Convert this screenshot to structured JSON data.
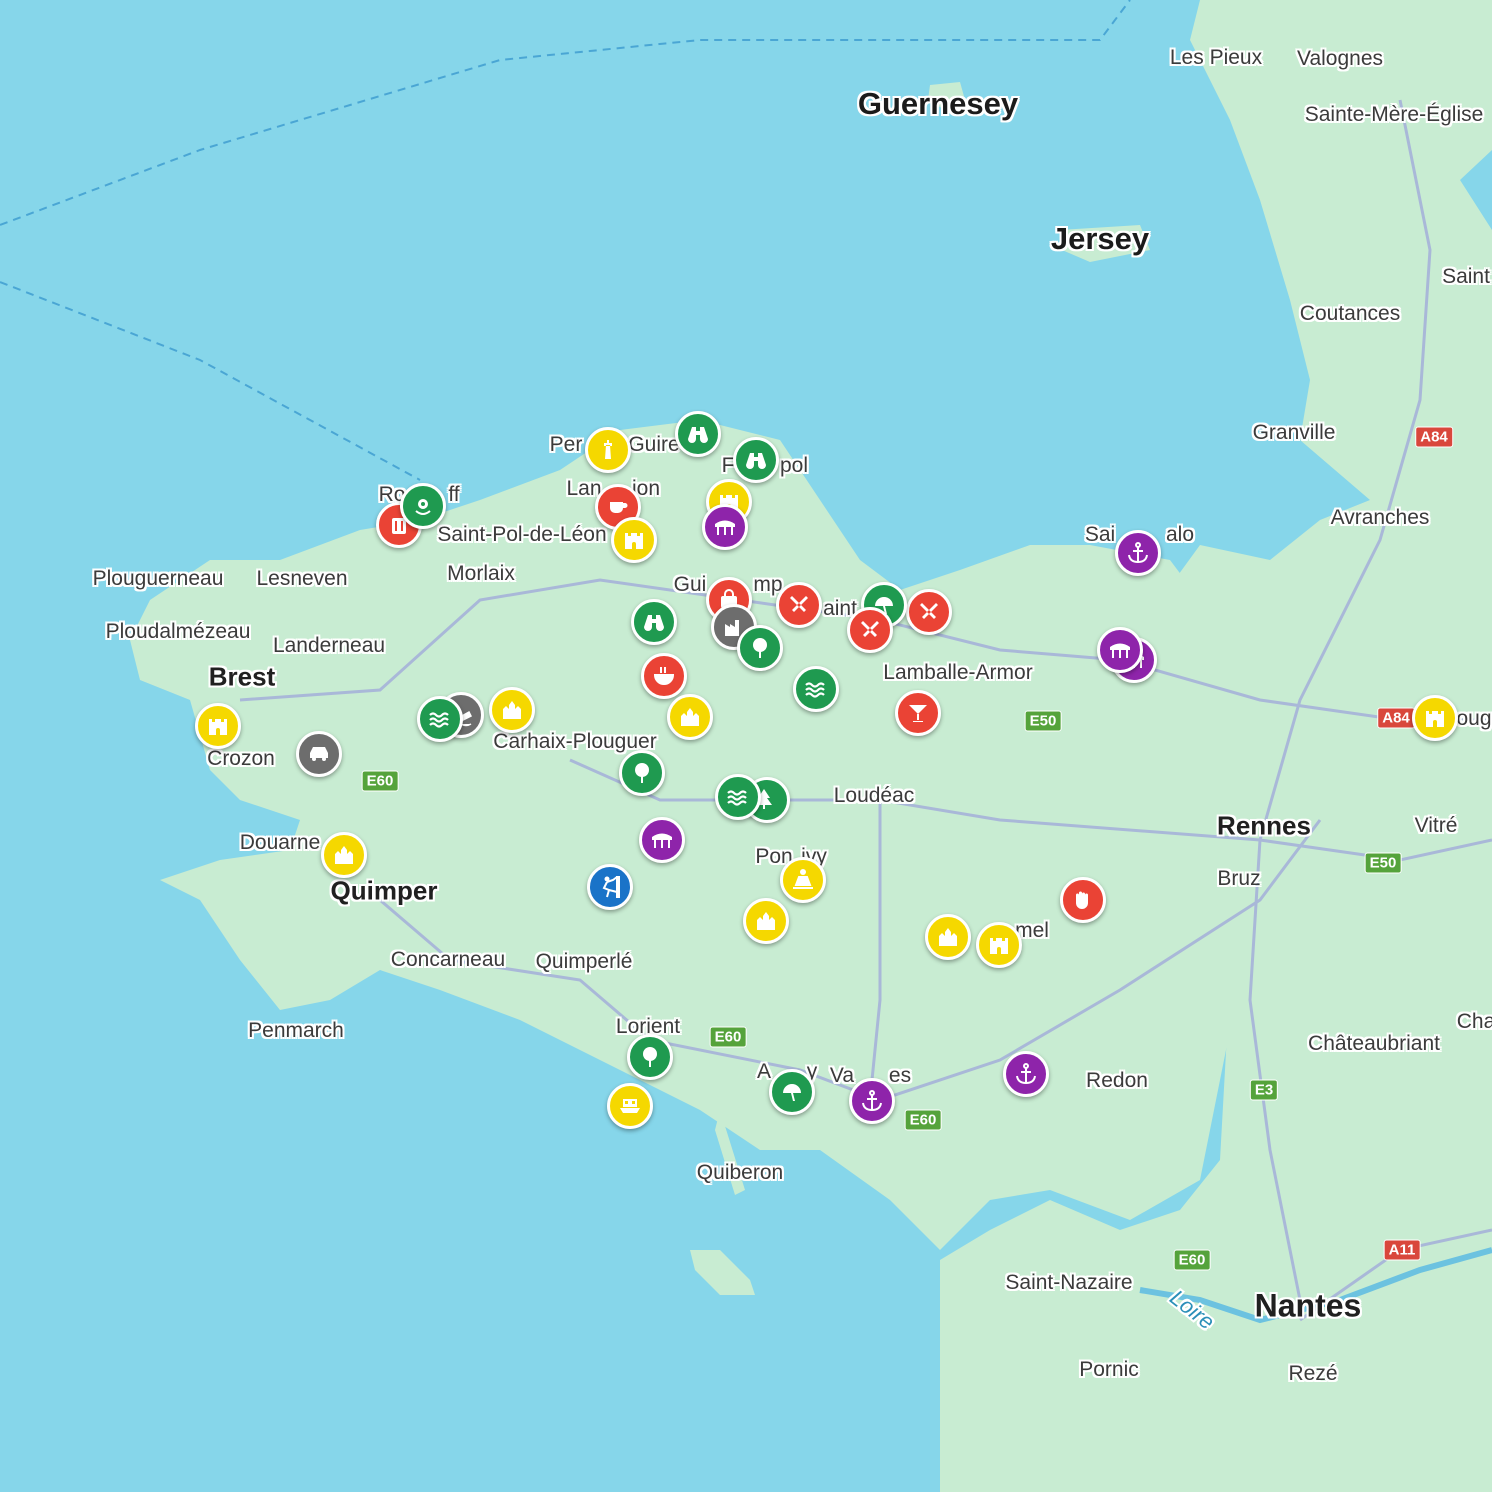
{
  "map": {
    "colors": {
      "sea": "#86d6ea",
      "land": "#c8ecd2",
      "road": "#a9b8d8"
    },
    "islands": [
      {
        "label": "Guernesey"
      },
      {
        "label": "Jersey"
      }
    ],
    "cities_major": [
      {
        "label": "Brest"
      },
      {
        "label": "Quimper"
      },
      {
        "label": "Rennes"
      },
      {
        "label": "Nantes"
      }
    ],
    "towns": [
      "Les Pieux",
      "Valognes",
      "Sainte-Mère-Église",
      "Saint",
      "Coutances",
      "Granville",
      "Avranches",
      "Sai",
      "alo",
      "Per",
      "Guire",
      "F",
      "pol",
      "Lan",
      "ion",
      "Ro",
      "ff",
      "Saint-Pol-de-Léon",
      "Morlaix",
      "Plouguerneau",
      "Lesneven",
      "Ploudalmézeau",
      "Landerneau",
      "Crozon",
      "Douarne",
      "Gui",
      "mp",
      "aint",
      "Lamballe-Armor",
      "Carhaix-Plouguer",
      "Loudéac",
      "Pon",
      "ivy",
      "Concarneau",
      "Quimperlé",
      "Penmarch",
      "Lorient",
      "A",
      "y",
      "Va",
      "es",
      "Quiberon",
      "Redon",
      "Châteaubriant",
      "Cha",
      "Vitré",
      "oug",
      "Bruz",
      "Saint-Nazaire",
      "Pornic",
      "Rezé",
      "mel"
    ],
    "river": "Loire",
    "shields": [
      "E60",
      "E50",
      "A84",
      "A84",
      "E50",
      "E60",
      "E60",
      "E3",
      "E60",
      "A11"
    ],
    "markers": [
      {
        "name": "lighthouse-marker",
        "category": "yellow",
        "color": "#f5d800",
        "icon": "lighthouse-icon"
      },
      {
        "name": "binoculars-marker",
        "category": "green",
        "color": "#1f9a50",
        "icon": "binoculars-icon"
      },
      {
        "name": "binoculars-marker",
        "category": "green",
        "color": "#1f9a50",
        "icon": "binoculars-icon"
      },
      {
        "name": "shop-marker",
        "category": "red",
        "color": "#ea4335",
        "icon": "shop-icon"
      },
      {
        "name": "flower-marker",
        "category": "green",
        "color": "#1f9a50",
        "icon": "flower-icon"
      },
      {
        "name": "cafe-marker",
        "category": "red",
        "color": "#ea4335",
        "icon": "cup-icon"
      },
      {
        "name": "castle-marker",
        "category": "yellow",
        "color": "#f5d800",
        "icon": "castle-icon"
      },
      {
        "name": "castle-marker",
        "category": "yellow",
        "color": "#f5d800",
        "icon": "castle-icon"
      },
      {
        "name": "bridge-marker",
        "category": "purple",
        "color": "#8e24aa",
        "icon": "bridge-icon"
      },
      {
        "name": "restaurant-marker",
        "category": "red",
        "color": "#ea4335",
        "icon": "cutlery-icon"
      },
      {
        "name": "shop-marker",
        "category": "red",
        "color": "#ea4335",
        "icon": "bag-icon"
      },
      {
        "name": "industry-marker",
        "category": "gray",
        "color": "#6d6d6d",
        "icon": "factory-icon"
      },
      {
        "name": "binoculars-marker",
        "category": "green",
        "color": "#1f9a50",
        "icon": "binoculars-icon"
      },
      {
        "name": "tree-marker",
        "category": "green",
        "color": "#1f9a50",
        "icon": "tree-icon"
      },
      {
        "name": "restaurant-marker",
        "category": "red",
        "color": "#ea4335",
        "icon": "cutlery-icon"
      },
      {
        "name": "beach-marker",
        "category": "green",
        "color": "#1f9a50",
        "icon": "umbrella-icon"
      },
      {
        "name": "restaurant-marker",
        "category": "red",
        "color": "#ea4335",
        "icon": "cutlery-icon"
      },
      {
        "name": "food-marker",
        "category": "red",
        "color": "#ea4335",
        "icon": "bowl-icon"
      },
      {
        "name": "monument-marker",
        "category": "yellow",
        "color": "#f5d800",
        "icon": "monument-icon"
      },
      {
        "name": "water-marker",
        "category": "green",
        "color": "#1f9a50",
        "icon": "waves-icon"
      },
      {
        "name": "bar-marker",
        "category": "red",
        "color": "#ea4335",
        "icon": "cocktail-icon"
      },
      {
        "name": "bridge-marker",
        "category": "purple",
        "color": "#8e24aa",
        "icon": "bridge-icon"
      },
      {
        "name": "anchor-marker",
        "category": "purple",
        "color": "#8e24aa",
        "icon": "anchor-icon"
      },
      {
        "name": "castle-marker",
        "category": "yellow",
        "color": "#f5d800",
        "icon": "castle-icon"
      },
      {
        "name": "castle-marker",
        "category": "yellow",
        "color": "#f5d800",
        "icon": "castle-icon"
      },
      {
        "name": "car-marker",
        "category": "gray",
        "color": "#6d6d6d",
        "icon": "car-icon"
      },
      {
        "name": "shipwreck-marker",
        "category": "gray",
        "color": "#6d6d6d",
        "icon": "shipwreck-icon"
      },
      {
        "name": "water-marker",
        "category": "green",
        "color": "#1f9a50",
        "icon": "waves-icon"
      },
      {
        "name": "monument-marker",
        "category": "yellow",
        "color": "#f5d800",
        "icon": "monument-icon"
      },
      {
        "name": "tree-marker",
        "category": "green",
        "color": "#1f9a50",
        "icon": "tree-icon"
      },
      {
        "name": "forest-marker",
        "category": "green",
        "color": "#1f9a50",
        "icon": "forest-icon"
      },
      {
        "name": "water-marker",
        "category": "green",
        "color": "#1f9a50",
        "icon": "waves-icon"
      },
      {
        "name": "monument-marker",
        "category": "yellow",
        "color": "#f5d800",
        "icon": "monument-icon"
      },
      {
        "name": "bridge-marker",
        "category": "purple",
        "color": "#8e24aa",
        "icon": "bridge-icon"
      },
      {
        "name": "meditation-marker",
        "category": "yellow",
        "color": "#f5d800",
        "icon": "meditation-icon"
      },
      {
        "name": "climbing-marker",
        "category": "blue",
        "color": "#1a73c8",
        "icon": "climbing-icon"
      },
      {
        "name": "monument-marker",
        "category": "yellow",
        "color": "#f5d800",
        "icon": "monument-icon"
      },
      {
        "name": "monument-marker",
        "category": "yellow",
        "color": "#f5d800",
        "icon": "monument-icon"
      },
      {
        "name": "castle-marker",
        "category": "yellow",
        "color": "#f5d800",
        "icon": "castle-icon"
      },
      {
        "name": "cooking-marker",
        "category": "red",
        "color": "#ea4335",
        "icon": "hand-icon"
      },
      {
        "name": "tree-marker",
        "category": "green",
        "color": "#1f9a50",
        "icon": "tree-icon"
      },
      {
        "name": "ferry-marker",
        "category": "yellow",
        "color": "#f5d800",
        "icon": "ferry-icon"
      },
      {
        "name": "beach-marker",
        "category": "green",
        "color": "#1f9a50",
        "icon": "umbrella-icon"
      },
      {
        "name": "anchor-marker",
        "category": "purple",
        "color": "#8e24aa",
        "icon": "anchor-icon"
      },
      {
        "name": "anchor-marker",
        "category": "purple",
        "color": "#8e24aa",
        "icon": "anchor-icon"
      },
      {
        "name": "bridge-marker",
        "category": "purple",
        "color": "#8e24aa",
        "icon": "bridge-icon"
      },
      {
        "name": "castle-marker",
        "category": "yellow",
        "color": "#f5d800",
        "icon": "castle-icon"
      }
    ]
  }
}
